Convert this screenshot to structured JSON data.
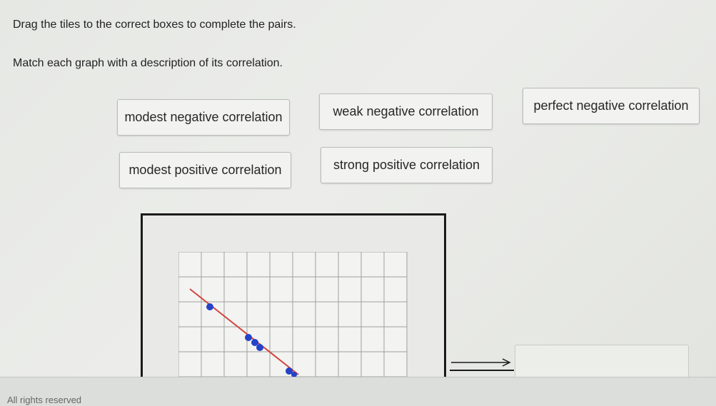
{
  "instructions": {
    "line1": "Drag the tiles to the correct boxes to complete the pairs.",
    "line2": "Match each graph with a description of its correlation."
  },
  "tiles": [
    "modest negative correlation",
    "weak negative correlation",
    "perfect negative correlation",
    "modest positive correlation",
    "strong positive correlation"
  ],
  "footer": "All rights reserved",
  "colors": {
    "point": "#2343c9",
    "trend_line": "#d2463f",
    "grid": "#9ea19c"
  }
}
